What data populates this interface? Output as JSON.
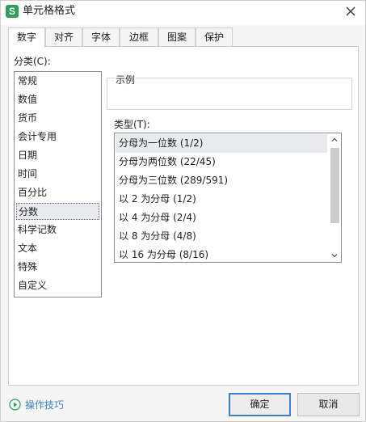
{
  "window": {
    "title": "单元格格式",
    "app_icon": "S"
  },
  "tabs": [
    {
      "label": "数字",
      "active": true
    },
    {
      "label": "对齐",
      "active": false
    },
    {
      "label": "字体",
      "active": false
    },
    {
      "label": "边框",
      "active": false
    },
    {
      "label": "图案",
      "active": false
    },
    {
      "label": "保护",
      "active": false
    }
  ],
  "category": {
    "label": "分类(C):",
    "items": [
      "常规",
      "数值",
      "货币",
      "会计专用",
      "日期",
      "时间",
      "百分比",
      "分数",
      "科学记数",
      "文本",
      "特殊",
      "自定义"
    ],
    "selected": "分数"
  },
  "sample": {
    "label": "示例"
  },
  "type": {
    "label": "类型(T):",
    "items": [
      "分母为一位数 (1/2)",
      "分母为两位数 (22/45)",
      "分母为三位数 (289/591)",
      "以 2 为分母 (1/2)",
      "以 4 为分母 (2/4)",
      "以 8 为分母 (4/8)",
      "以 16 为分母 (8/16)"
    ],
    "selected": "分母为一位数 (1/2)"
  },
  "footer": {
    "tips_label": "操作技巧",
    "ok_label": "确定",
    "cancel_label": "取消"
  },
  "colors": {
    "accent": "#3a7fd5",
    "link": "#3a86c8",
    "app_icon_bg": "#2c9e5b",
    "selection": "#e8eaee"
  },
  "icons": {
    "app": "wps-spreadsheet-icon",
    "close": "close-icon",
    "tips": "play-circle-icon"
  }
}
